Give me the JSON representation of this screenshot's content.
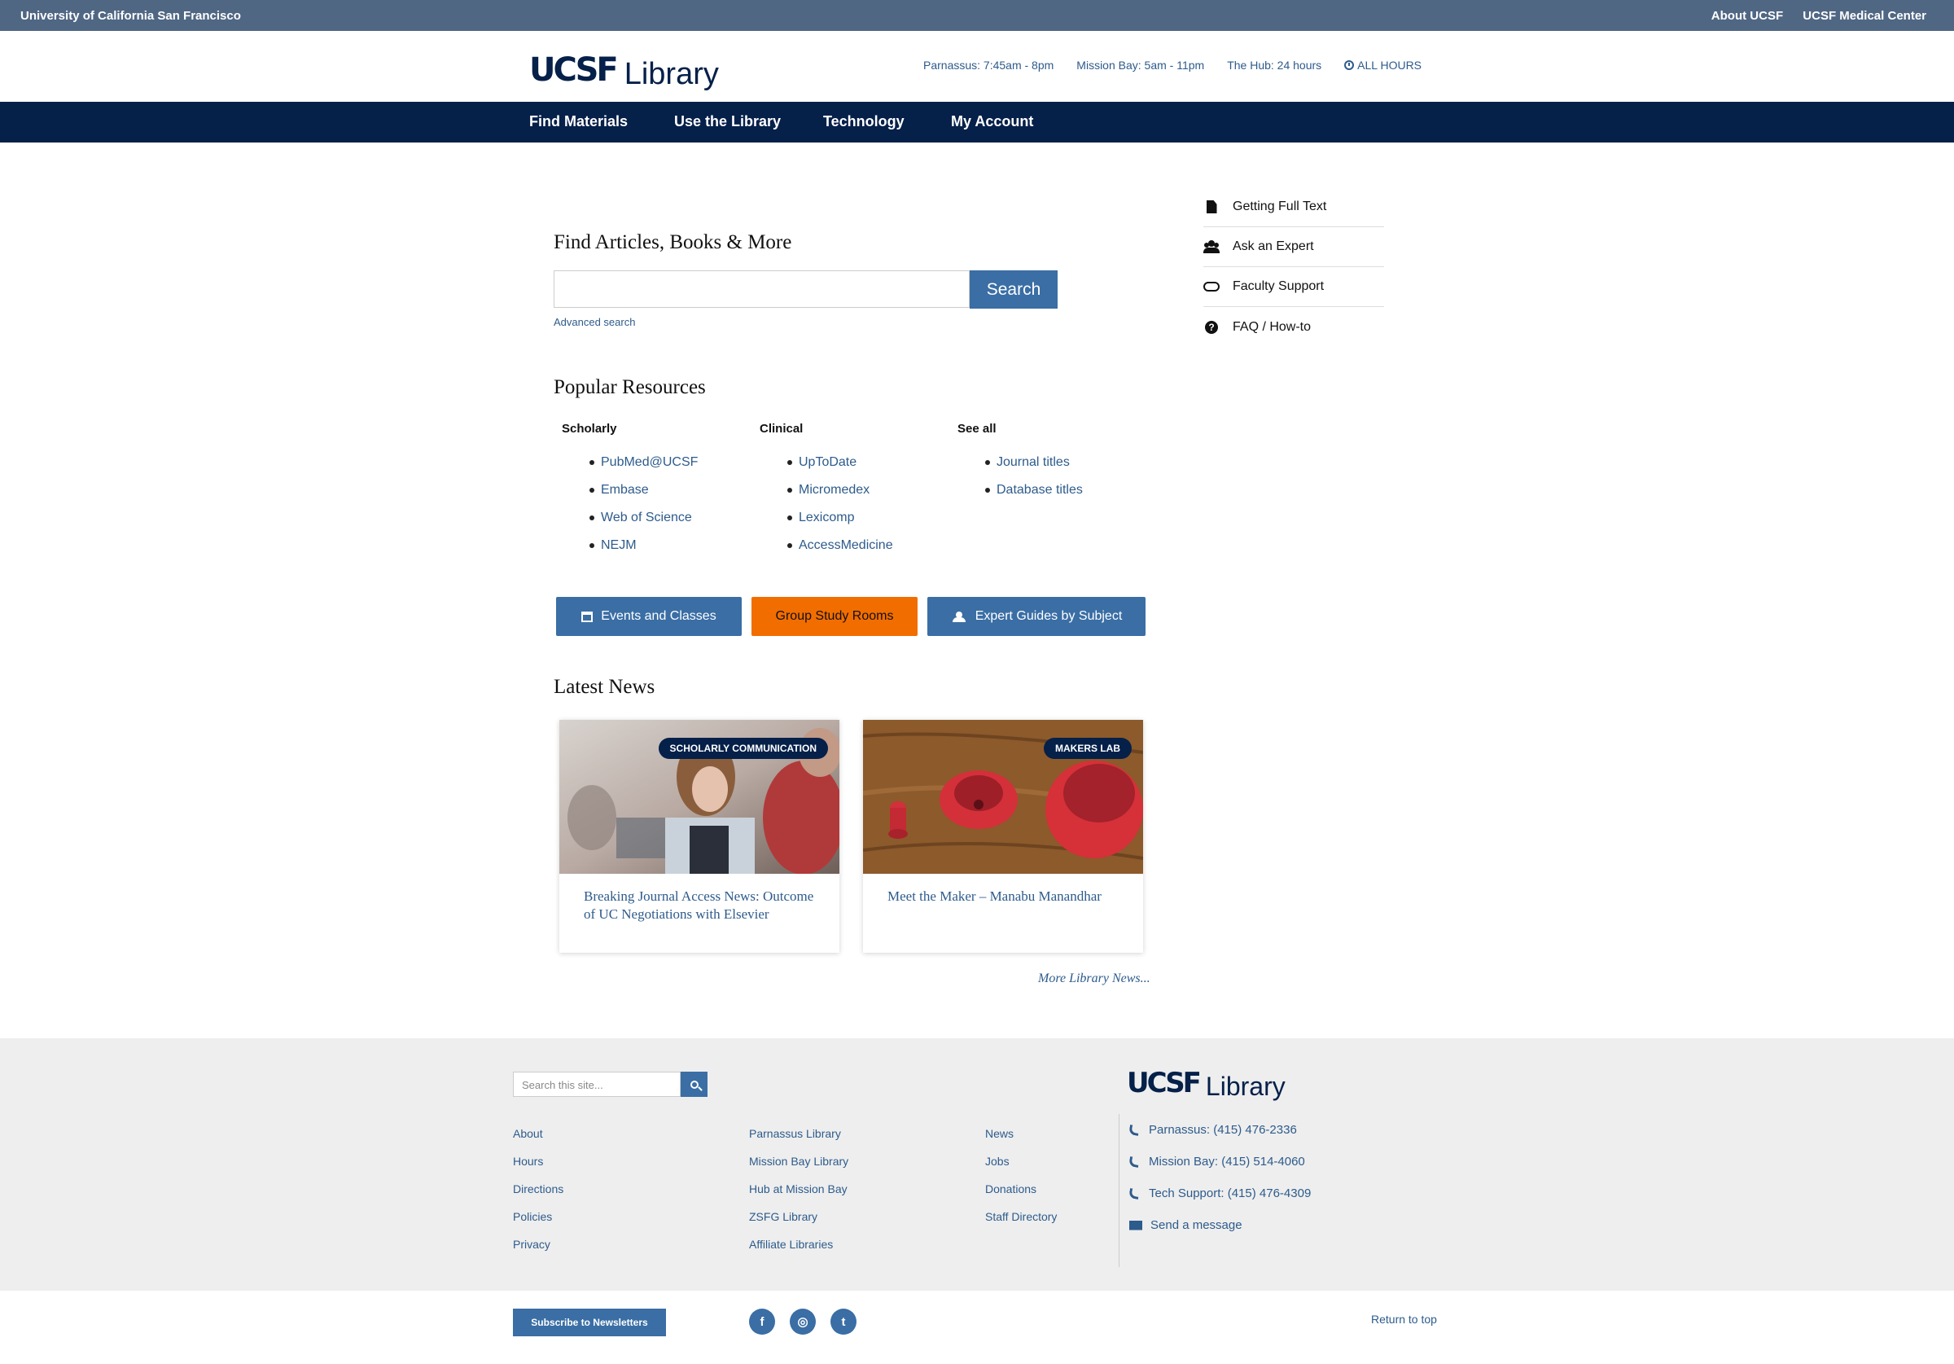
{
  "utility": {
    "brand": "University of California San Francisco",
    "links": [
      "About UCSF",
      "UCSF Medical Center"
    ]
  },
  "header": {
    "logo_mark": "UCSF",
    "logo_text": "Library",
    "hours": [
      "Parnassus: 7:45am - 8pm",
      "Mission Bay: 5am - 11pm",
      "The Hub: 24 hours"
    ],
    "all_hours": "ALL HOURS"
  },
  "nav": [
    "Find Materials",
    "Use the Library",
    "Technology",
    "My Account"
  ],
  "search": {
    "heading": "Find Articles, Books & More",
    "button": "Search",
    "advanced": "Advanced search",
    "value": ""
  },
  "sidebar": [
    "Getting Full Text",
    "Ask an Expert",
    "Faculty Support",
    "FAQ / How-to"
  ],
  "resources": {
    "heading": "Popular Resources",
    "columns": [
      {
        "head": "Scholarly",
        "items": [
          "PubMed@UCSF",
          "Embase",
          "Web of Science",
          "NEJM"
        ]
      },
      {
        "head": "Clinical",
        "items": [
          "UpToDate",
          "Micromedex",
          "Lexicomp",
          "AccessMedicine"
        ]
      },
      {
        "head": "See all",
        "items": [
          "Journal titles",
          "Database titles"
        ]
      }
    ]
  },
  "buttons": [
    "Events and Classes",
    "Group Study Rooms",
    "Expert Guides by Subject"
  ],
  "news": {
    "heading": "Latest News",
    "cards": [
      {
        "tag": "SCHOLARLY COMMUNICATION",
        "title": "Breaking Journal Access News: Outcome of UC Negotiations with Elsevier"
      },
      {
        "tag": "MAKERS LAB",
        "title": "Meet the Maker – Manabu Manandhar"
      }
    ],
    "more": "More Library News..."
  },
  "footer": {
    "search_placeholder": "Search this site...",
    "col1": [
      "About",
      "Hours",
      "Directions",
      "Policies",
      "Privacy"
    ],
    "col2": [
      "Parnassus Library",
      "Mission Bay Library",
      "Hub at Mission Bay",
      "ZSFG Library",
      "Affiliate Libraries"
    ],
    "col3": [
      "News",
      "Jobs",
      "Donations",
      "Staff Directory"
    ],
    "logo_mark": "UCSF",
    "logo_text": "Library",
    "contacts": [
      "Parnassus: (415) 476-2336",
      "Mission Bay: (415) 514-4060",
      "Tech Support: (415) 476-4309",
      "Send a message"
    ],
    "subscribe": "Subscribe to Newsletters",
    "social": [
      "f",
      "◎",
      "t"
    ],
    "return_top": "Return to top"
  },
  "colors": {
    "navy": "#052049",
    "blue": "#3a6ea5",
    "orange": "#f26d00",
    "utility": "#506784"
  }
}
